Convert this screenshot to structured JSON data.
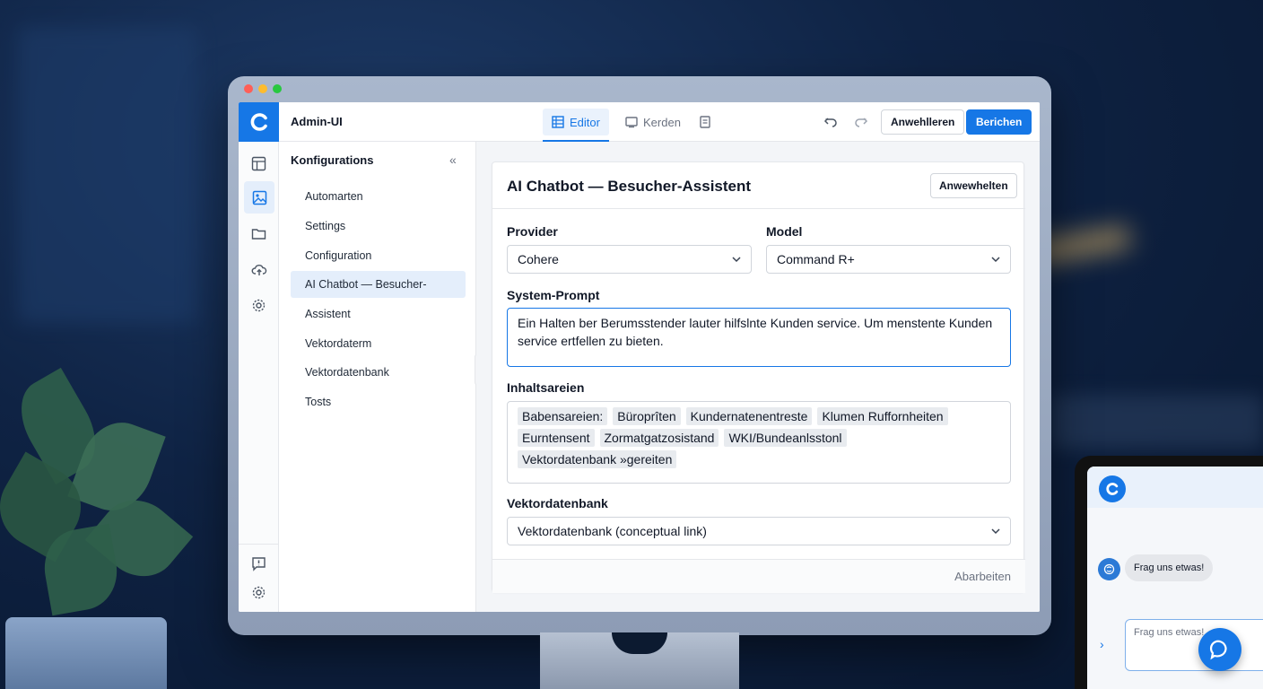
{
  "window": {
    "traffic_lights": [
      "#ff5f57",
      "#febc2e",
      "#28c840"
    ]
  },
  "header": {
    "title": "Admin-UI",
    "tabs": [
      {
        "label": "Editor",
        "icon": "grid-icon",
        "active": true
      },
      {
        "label": "Kerden",
        "icon": "monitor-icon",
        "active": false
      },
      {
        "label": "",
        "icon": "document-icon",
        "active": false
      }
    ],
    "undo_icon": "undo-icon",
    "redo_icon": "redo-icon",
    "secondary_button": "Anwehlleren",
    "primary_button": "Berichen",
    "accent": "#1677e6"
  },
  "rail": {
    "items": [
      "layout-icon",
      "image-icon",
      "folder-icon",
      "cloud-upload-icon",
      "gear-icon"
    ],
    "active_index": 1,
    "bottom": [
      "feedback-icon",
      "settings-icon"
    ]
  },
  "sidebar": {
    "title": "Konfigurations",
    "items": [
      {
        "label": "Automarten",
        "active": false
      },
      {
        "label": "Settings",
        "active": false
      },
      {
        "label": "Configuration",
        "active": false
      },
      {
        "label": "AI Chatbot — Besucher-",
        "active": true
      },
      {
        "label": "Assistent",
        "active": false
      },
      {
        "label": "Vektordaterm",
        "active": false
      },
      {
        "label": "Vektordatenbank",
        "active": false
      },
      {
        "label": "Tosts",
        "active": false
      }
    ]
  },
  "panel": {
    "title": "AI Chatbot — Besucher-Assistent",
    "header_button": "Anwewhelten",
    "provider": {
      "label": "Provider",
      "value": "Cohere"
    },
    "model": {
      "label": "Model",
      "value": "Command R+"
    },
    "system_prompt": {
      "label": "System-Prompt",
      "value": "Ein Halten ber Berumsstender lauter hilfslnte Kunden service. Um menstente Kunden service ertfellen zu bieten."
    },
    "content_sources": {
      "label": "Inhaltsareien",
      "tags": [
        "Babensareien:",
        "Büroprîten",
        "Kundernatenentreste",
        "Klumen Ruffornheiten",
        "Eurntensent",
        "Zormatgatzosistand",
        "WKI/Bundeanlsstonl",
        "Vektordatenbank »gereiten"
      ]
    },
    "vector_db": {
      "label": "Vektordatenbank",
      "value": "Vektordatenbank (conceptual link)"
    },
    "footer_link": "Abarbeiten"
  },
  "chat_widget": {
    "greeting": "Frag uns etwas!",
    "input_placeholder": "Frag uns etwas!"
  }
}
